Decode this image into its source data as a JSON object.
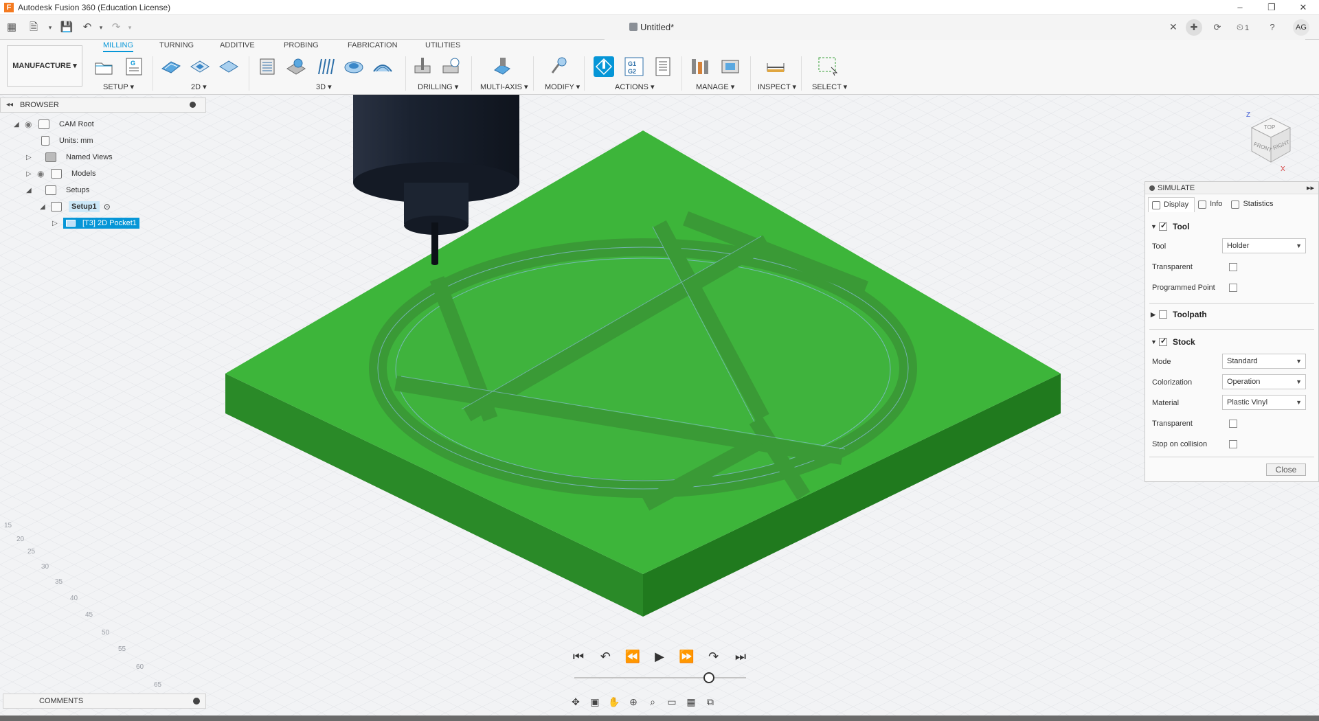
{
  "window": {
    "title": "Autodesk Fusion 360 (Education License)",
    "logo": "F",
    "controls": [
      "–",
      "❐",
      "✕"
    ]
  },
  "document": {
    "title": "Untitled*",
    "close": "✕"
  },
  "topright": {
    "jobs_count": "1",
    "help": "?",
    "avatar": "AG"
  },
  "ribbon": {
    "workspace": "MANUFACTURE ▾",
    "tabs": [
      "MILLING",
      "TURNING",
      "ADDITIVE",
      "PROBING",
      "FABRICATION",
      "UTILITIES"
    ],
    "groups": [
      "SETUP ▾",
      "2D ▾",
      "3D ▾",
      "DRILLING ▾",
      "MULTI-AXIS ▾",
      "MODIFY ▾",
      "ACTIONS ▾",
      "MANAGE ▾",
      "INSPECT ▾",
      "SELECT ▾"
    ],
    "active_tab": "MILLING",
    "accent": "#0696d7"
  },
  "browser": {
    "title": "BROWSER",
    "items": [
      {
        "label": "CAM Root"
      },
      {
        "label": "Units: mm"
      },
      {
        "label": "Named Views"
      },
      {
        "label": "Models"
      },
      {
        "label": "Setups"
      },
      {
        "label": "Setup1"
      },
      {
        "label": "[T3] 2D Pocket1"
      }
    ]
  },
  "simulate": {
    "title": "SIMULATE",
    "tabs": [
      "Display",
      "Info",
      "Statistics"
    ],
    "tool_section": {
      "title": "Tool",
      "checked": true,
      "tool_label": "Tool",
      "tool_value": "Holder",
      "transparent_label": "Transparent",
      "programmed_point_label": "Programmed Point"
    },
    "toolpath_section": {
      "title": "Toolpath",
      "checked": false
    },
    "stock_section": {
      "title": "Stock",
      "checked": true,
      "mode_label": "Mode",
      "mode_value": "Standard",
      "colorization_label": "Colorization",
      "colorization_value": "Operation",
      "material_label": "Material",
      "material_value": "Plastic Vinyl",
      "transparent_label": "Transparent",
      "stop_label": "Stop on collision"
    },
    "close_label": "Close"
  },
  "viewcube": {
    "top": "TOP",
    "front": "FRONT",
    "right": "RIGHT",
    "z": "Z",
    "x": "X"
  },
  "comments": {
    "title": "COMMENTS"
  },
  "colors": {
    "stock_top": "#3db53a",
    "stock_side_left": "#2a8a28",
    "stock_side_right": "#207a1e",
    "pocket_floor": "#3fb33d",
    "spindle": "#1b2230"
  },
  "playback": [
    "⏮",
    "↶",
    "⏪",
    "▶",
    "⏩",
    "↷",
    "⏭"
  ],
  "navbar_icons": [
    "orbit-icon",
    "look-at-icon",
    "pan-icon",
    "zoom-icon",
    "fit-icon",
    "display-icon",
    "grid-icon",
    "viewports-icon"
  ]
}
